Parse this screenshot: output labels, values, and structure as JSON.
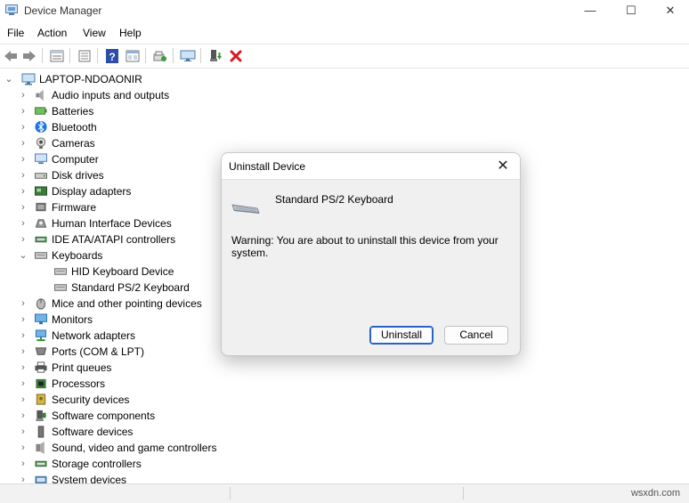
{
  "window": {
    "title": "Device Manager",
    "minimize": "—",
    "maximize": "☐",
    "close": "✕"
  },
  "menu": [
    "File",
    "Action",
    "View",
    "Help"
  ],
  "toolbar": [
    "back-icon",
    "forward-icon",
    "properties-icon",
    "list-icon",
    "help-icon",
    "resource-view-icon",
    "scan-hardware-icon",
    "monitor-icon",
    "add-driver-icon",
    "uninstall-icon"
  ],
  "tree": {
    "root": "LAPTOP-NDOAONIR",
    "categories": [
      {
        "label": "Audio inputs and outputs",
        "icon": "speaker-icon"
      },
      {
        "label": "Batteries",
        "icon": "battery-icon"
      },
      {
        "label": "Bluetooth",
        "icon": "bluetooth-icon"
      },
      {
        "label": "Cameras",
        "icon": "camera-icon"
      },
      {
        "label": "Computer",
        "icon": "computer-icon"
      },
      {
        "label": "Disk drives",
        "icon": "disk-icon"
      },
      {
        "label": "Display adapters",
        "icon": "display-adapter-icon"
      },
      {
        "label": "Firmware",
        "icon": "firmware-icon"
      },
      {
        "label": "Human Interface Devices",
        "icon": "hid-icon"
      },
      {
        "label": "IDE ATA/ATAPI controllers",
        "icon": "ide-icon"
      },
      {
        "label": "Keyboards",
        "icon": "keyboard-icon",
        "expanded": true,
        "children": [
          "HID Keyboard Device",
          "Standard PS/2 Keyboard"
        ]
      },
      {
        "label": "Mice and other pointing devices",
        "icon": "mouse-icon"
      },
      {
        "label": "Monitors",
        "icon": "monitor-icon"
      },
      {
        "label": "Network adapters",
        "icon": "network-icon"
      },
      {
        "label": "Ports (COM & LPT)",
        "icon": "port-icon"
      },
      {
        "label": "Print queues",
        "icon": "printer-icon"
      },
      {
        "label": "Processors",
        "icon": "processor-icon"
      },
      {
        "label": "Security devices",
        "icon": "security-icon"
      },
      {
        "label": "Software components",
        "icon": "software-component-icon"
      },
      {
        "label": "Software devices",
        "icon": "software-device-icon"
      },
      {
        "label": "Sound, video and game controllers",
        "icon": "sound-icon"
      },
      {
        "label": "Storage controllers",
        "icon": "storage-icon"
      },
      {
        "label": "System devices",
        "icon": "system-icon"
      }
    ]
  },
  "dialog": {
    "title": "Uninstall Device",
    "close": "✕",
    "device_name": "Standard PS/2 Keyboard",
    "warning": "Warning: You are about to uninstall this device from your system.",
    "uninstall_label": "Uninstall",
    "cancel_label": "Cancel"
  },
  "watermark": "wsxdn.com",
  "colors": {
    "accent": "#2a63c8",
    "delete_red": "#d71920"
  }
}
